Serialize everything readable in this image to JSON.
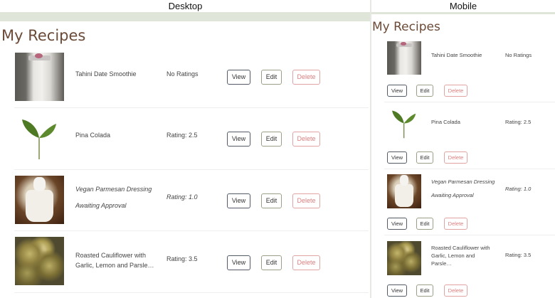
{
  "desktop": {
    "label": "Desktop",
    "heading": "My Recipes",
    "view_label": "View",
    "edit_label": "Edit",
    "delete_label": "Delete"
  },
  "mobile": {
    "label": "Mobile",
    "heading": "My Recipes",
    "view_label": "View",
    "edit_label": "Edit",
    "delete_label": "Delete"
  },
  "recipes": [
    {
      "name": "Tahini Date Smoothie",
      "status": "",
      "rating": "No Ratings",
      "image": "smoothie-jar-photo",
      "pending": false
    },
    {
      "name": "Pina Colada",
      "status": "",
      "rating": "Rating: 2.5",
      "image": "green-leaf-sprout-photo",
      "pending": false
    },
    {
      "name": "Vegan Parmesan Dressing",
      "status": "Awaiting Approval",
      "rating": "Rating: 1.0",
      "image": "dressing-bowl-photo",
      "pending": true
    },
    {
      "name": "Roasted Cauliflower with Garlic, Lemon and Parsle…",
      "mobile_name": "Roasted Cauliflower with Garlic, Lemon and Parsle…",
      "status": "",
      "rating": "Rating: 3.5",
      "image": "roasted-cauliflower-photo",
      "pending": false
    }
  ],
  "colors": {
    "heading": "#6b4a37",
    "band": "#dfe5d8",
    "delete": "#d87f7f"
  }
}
